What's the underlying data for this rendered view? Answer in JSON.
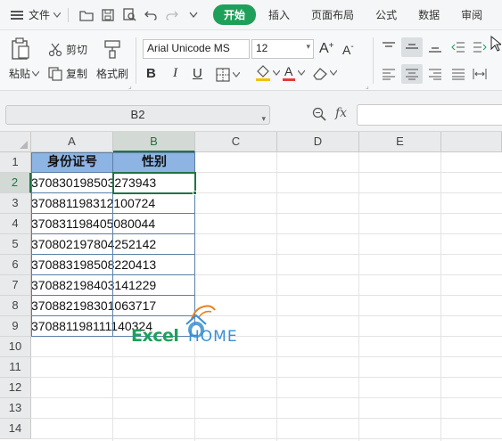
{
  "menubar": {
    "file_label": "文件",
    "tabs": [
      {
        "label": "开始",
        "active": true
      },
      {
        "label": "插入",
        "active": false
      },
      {
        "label": "页面布局",
        "active": false
      },
      {
        "label": "公式",
        "active": false
      },
      {
        "label": "数据",
        "active": false
      },
      {
        "label": "审阅",
        "active": false
      }
    ]
  },
  "ribbon": {
    "paste_label": "粘贴",
    "cut_label": "剪切",
    "copy_label": "复制",
    "format_painter_label": "格式刷",
    "font_name": "Arial Unicode MS",
    "font_size": "12",
    "bold_glyph": "B",
    "italic_glyph": "I",
    "underline_glyph": "U",
    "grow_glyph": "A",
    "shrink_glyph": "A"
  },
  "formula_bar": {
    "name_box": "B2",
    "fx_label": "fx",
    "value": ""
  },
  "grid": {
    "columns": [
      "A",
      "B",
      "C",
      "D",
      "E"
    ],
    "rows": [
      "1",
      "2",
      "3",
      "4",
      "5",
      "6",
      "7",
      "8",
      "9",
      "10",
      "11",
      "12",
      "13",
      "14"
    ],
    "selected_column": "B",
    "selected_row": "2"
  },
  "table": {
    "headers": [
      "身份证号",
      "性别"
    ],
    "rows": [
      [
        "370830198503273943",
        ""
      ],
      [
        "370881198312100724",
        ""
      ],
      [
        "370831198405080044",
        ""
      ],
      [
        "370802197804252142",
        ""
      ],
      [
        "370883198508220413",
        ""
      ],
      [
        "370882198403141229",
        ""
      ],
      [
        "370882198301063717",
        ""
      ],
      [
        "370881198111140324",
        ""
      ]
    ]
  },
  "watermark": {
    "text_left": "Excel",
    "text_right": "HOME"
  },
  "colors": {
    "accent_green": "#1fa05a",
    "selection_green": "#217346",
    "header_fill": "#8db4e2",
    "table_border": "#5b7fa7"
  }
}
